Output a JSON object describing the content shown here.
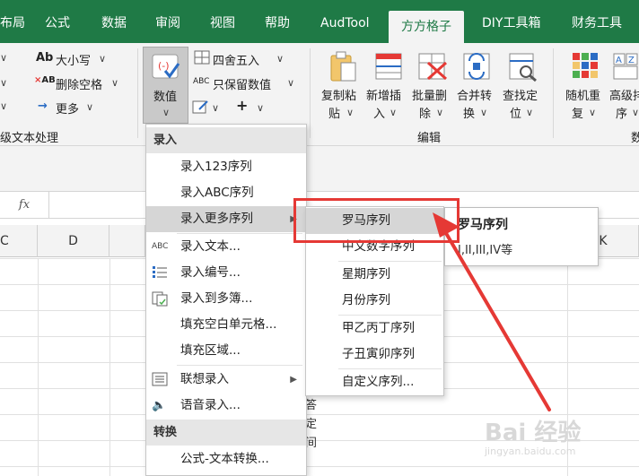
{
  "tabs": [
    "布局",
    "公式",
    "数据",
    "审阅",
    "视图",
    "帮助",
    "AudTool",
    "方方格子",
    "DIY工具箱",
    "财务工具"
  ],
  "active_tab": "方方格子",
  "ribbon": {
    "text_group": {
      "items": [
        "大小写",
        "删除空格",
        "更多"
      ],
      "group_label": "级文本处理"
    },
    "numeric": {
      "button_top": "数值",
      "items": [
        "四舍五入",
        "只保留数值"
      ]
    },
    "edit_group": {
      "buttons": [
        {
          "line1": "复制粘",
          "line2": "贴"
        },
        {
          "line1": "新增插",
          "line2": "入"
        },
        {
          "line1": "批量删",
          "line2": "除"
        },
        {
          "line1": "合并转",
          "line2": "换"
        },
        {
          "line1": "查找定",
          "line2": "位"
        }
      ],
      "group_label": "编辑"
    },
    "right_group": {
      "buttons": [
        {
          "line1": "随机重",
          "line2": "复"
        },
        {
          "line1": "高级排",
          "line2": "序"
        }
      ],
      "group_label_partial": "数"
    }
  },
  "formula_bar": {
    "fx": "fx"
  },
  "columns": [
    "C",
    "D",
    "K"
  ],
  "menu": {
    "section1": "录入",
    "items_a": [
      "录入123序列",
      "录入ABC序列",
      "录入更多序列"
    ],
    "items_b": [
      "录入文本...",
      "录入编号...",
      "录入到多簿..."
    ],
    "items_c": [
      "填充空白单元格...",
      "填充区域..."
    ],
    "items_d": [
      "联想录入",
      "语音录入..."
    ],
    "section2": "转换",
    "items_e": [
      "公式-文本转换..."
    ],
    "abc_icon": "ABC"
  },
  "submenu": {
    "items": [
      "罗马序列",
      "中文数字序列",
      "星期序列",
      "月份序列",
      "甲乙丙丁序列",
      "子丑寅卯序列",
      "自定义序列..."
    ]
  },
  "tooltip": {
    "title": "罗马序列",
    "desc": "I,II,III,IV等"
  },
  "partial_cells": [
    "答",
    "定",
    "间"
  ],
  "watermark": {
    "brand": "Bai 经验",
    "url": "jingyan.baidu.com"
  },
  "colors": {
    "accent_green": "#1f7a46",
    "annotation_red": "#e53935"
  }
}
